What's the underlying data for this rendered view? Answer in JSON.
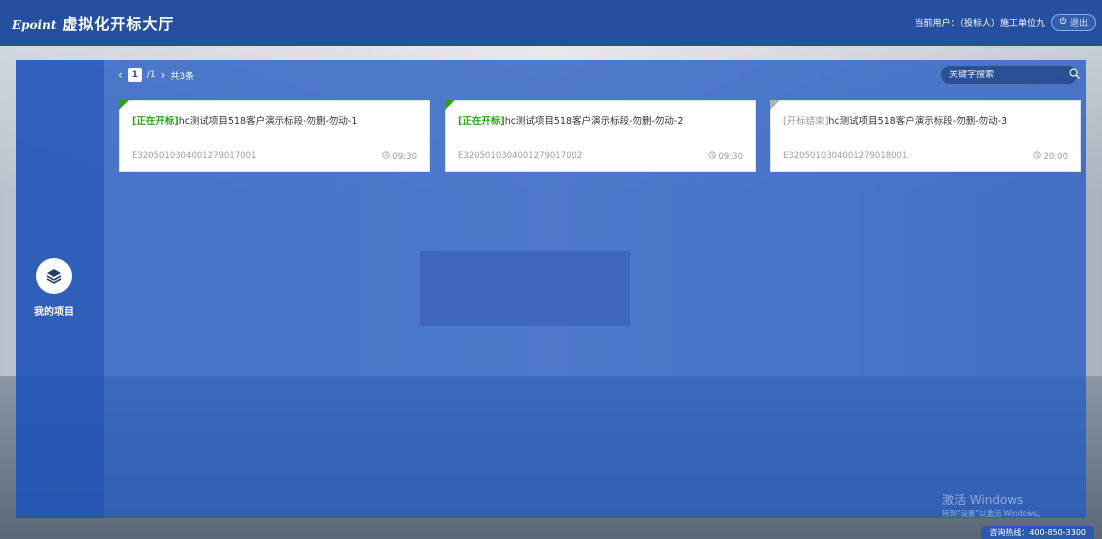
{
  "header": {
    "logo_text": "Epoint",
    "title": "虚拟化开标大厅",
    "current_user": "当前用户：（投标人）施工单位九",
    "logout_label": "退出"
  },
  "sidebar": {
    "items": [
      {
        "label": "我的项目",
        "icon": "layers-icon"
      }
    ]
  },
  "pagination": {
    "prev_icon": "chevron-left-icon",
    "current_page": "1",
    "total_pages": "/1",
    "next_icon": "chevron-right-icon",
    "total_text": "共3条"
  },
  "search": {
    "placeholder": "关键字搜索",
    "icon": "search-icon"
  },
  "colors": {
    "header": "#2550a0",
    "panel": "#255cc4",
    "status_open": "#2aa515",
    "status_closed": "#999999"
  },
  "cards": [
    {
      "status": "[正在开标]",
      "status_color": "#2aa515",
      "name": "hc测试项目518客户演示标段-勿删-勿动-1",
      "code": "E3205010304001279017001",
      "time": "09:30"
    },
    {
      "status": "[正在开标]",
      "status_color": "#2aa515",
      "name": "hc测试项目518客户演示标段-勿删-勿动-2",
      "code": "E3205010304001279017002",
      "time": "09:30"
    },
    {
      "status": "[开标结束]",
      "status_color": "#999999",
      "name": "hc测试项目518客户演示标段-勿删-勿动-3",
      "code": "E3205010304001279018001",
      "time": "20:00"
    }
  ],
  "watermark": {
    "title": "激活 Windows",
    "subtitle": "转到\"设置\"以激活 Windows。"
  },
  "footer": {
    "hotline": "咨询热线：400-850-3300"
  }
}
